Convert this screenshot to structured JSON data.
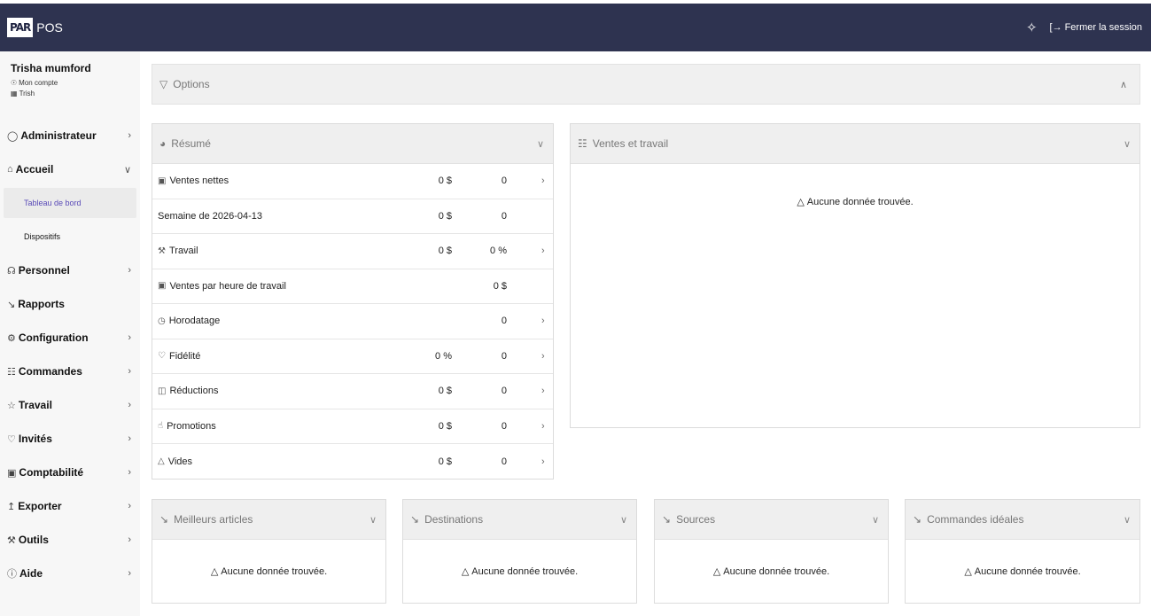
{
  "header": {
    "logo_mark": "PAR",
    "logo_text": "POS",
    "logout_label": "Fermer la session"
  },
  "user": {
    "name": "Trisha mumford",
    "account_label": "Mon compte",
    "store_label": "Trish"
  },
  "nav": {
    "administrateur": "Administrateur",
    "accueil": "Accueil",
    "tableau_de_bord": "Tableau de bord",
    "dispositifs": "Dispositifs",
    "personnel": "Personnel",
    "rapports": "Rapports",
    "configuration": "Configuration",
    "commandes": "Commandes",
    "travail": "Travail",
    "invites": "Invités",
    "comptabilite": "Comptabilité",
    "exporter": "Exporter",
    "outils": "Outils",
    "aide": "Aide"
  },
  "options": {
    "title": "Options"
  },
  "resume": {
    "title": "Résumé",
    "rows": [
      {
        "label": "Ventes nettes",
        "v1": "0 $",
        "v2": "0",
        "icon": "cash-icon",
        "chevron": true
      },
      {
        "label": "Semaine de 2026-04-13",
        "v1": "0 $",
        "v2": "0",
        "icon": "",
        "chevron": false
      },
      {
        "label": "Travail",
        "v1": "0 $",
        "v2": "0 %",
        "icon": "wrench-icon",
        "chevron": true
      },
      {
        "label": "Ventes par heure de travail",
        "v1": "",
        "v2": "0 $",
        "icon": "cash-icon",
        "chevron": false
      },
      {
        "label": "Horodatage",
        "v1": "",
        "v2": "0",
        "icon": "clock-icon",
        "chevron": true
      },
      {
        "label": "Fidélité",
        "v1": "0 %",
        "v2": "0",
        "icon": "heart-icon",
        "chevron": true
      },
      {
        "label": "Réductions",
        "v1": "0 $",
        "v2": "0",
        "icon": "gift-icon",
        "chevron": true
      },
      {
        "label": "Promotions",
        "v1": "0 $",
        "v2": "0",
        "icon": "thumbs-up-icon",
        "chevron": true
      },
      {
        "label": "Vides",
        "v1": "0 $",
        "v2": "0",
        "icon": "warning-icon",
        "chevron": true
      }
    ]
  },
  "ventes_travail": {
    "title": "Ventes et travail",
    "empty": "Aucune donnée trouvée."
  },
  "meilleurs": {
    "title": "Meilleurs articles",
    "empty": "Aucune donnée trouvée."
  },
  "destinations": {
    "title": "Destinations",
    "empty": "Aucune donnée trouvée."
  },
  "sources": {
    "title": "Sources",
    "empty": "Aucune donnée trouvée."
  },
  "commandes_ideales": {
    "title": "Commandes idéales",
    "empty": "Aucune donnée trouvée."
  }
}
